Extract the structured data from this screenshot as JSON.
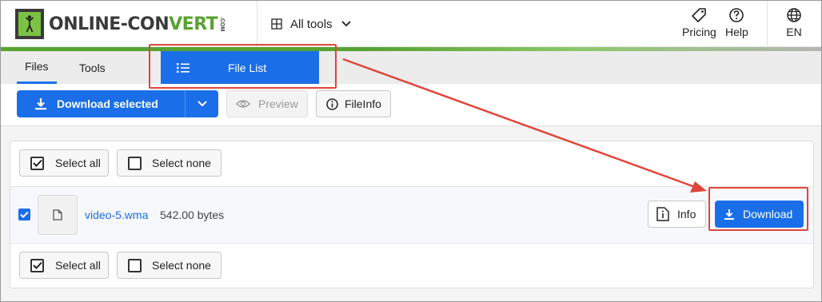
{
  "header": {
    "logo_text_a": "ONLINE-CON",
    "logo_text_b": "VERT",
    "logo_com": ".COM",
    "all_tools_label": "All tools",
    "pricing_label": "Pricing",
    "help_label": "Help",
    "language_label": "EN"
  },
  "tabs": {
    "files_label": "Files",
    "tools_label": "Tools",
    "file_list_label": "File List"
  },
  "toolbar": {
    "download_selected_label": "Download selected",
    "preview_label": "Preview",
    "fileinfo_label": "FileInfo"
  },
  "file_list": {
    "select_all_label": "Select all",
    "select_none_label": "Select none",
    "files": [
      {
        "name": "video-5.wma",
        "size": "542.00 bytes",
        "checked": true,
        "info_label": "Info",
        "download_label": "Download"
      }
    ]
  },
  "colors": {
    "primary_blue": "#1a6fe8",
    "brand_green": "#58a232",
    "annotation_red": "#e0453a"
  }
}
